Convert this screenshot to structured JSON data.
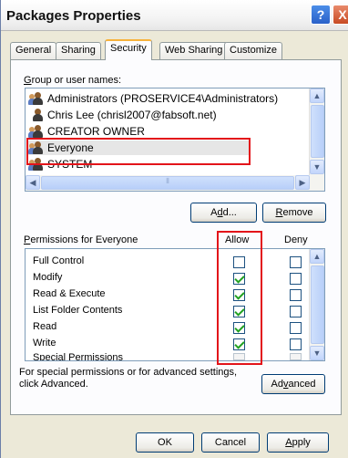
{
  "window": {
    "title": "Packages Properties",
    "help_glyph": "?",
    "close_glyph": "X"
  },
  "tabs": [
    {
      "label": "General",
      "active": false
    },
    {
      "label": "Sharing",
      "active": false
    },
    {
      "label": "Security",
      "active": true
    },
    {
      "label": "Web Sharing",
      "active": false
    },
    {
      "label": "Customize",
      "active": false
    }
  ],
  "security": {
    "group_label_pre": "G",
    "group_label_rest": "roup or user names:",
    "users": [
      {
        "name": "Administrators (PROSERVICE4\\Administrators)",
        "icon": "group-icon"
      },
      {
        "name": "Chris Lee (chrisl2007@fabsoft.net)",
        "icon": "user-icon"
      },
      {
        "name": "CREATOR OWNER",
        "icon": "group-icon"
      },
      {
        "name": "Everyone",
        "icon": "group-icon",
        "selected": true
      },
      {
        "name": "SYSTEM",
        "icon": "group-icon"
      }
    ],
    "add_label_pre": "A",
    "add_label_u": "d",
    "add_label_post": "d...",
    "remove_label_pre": "",
    "remove_label_u": "R",
    "remove_label_post": "emove",
    "permissions_label_u": "P",
    "permissions_label_rest": "ermissions for Everyone",
    "allow_header": "Allow",
    "deny_header": "Deny",
    "permissions": [
      {
        "name": "Full Control",
        "allow": false,
        "deny": false
      },
      {
        "name": "Modify",
        "allow": true,
        "deny": false
      },
      {
        "name": "Read & Execute",
        "allow": true,
        "deny": false
      },
      {
        "name": "List Folder Contents",
        "allow": true,
        "deny": false
      },
      {
        "name": "Read",
        "allow": true,
        "deny": false
      },
      {
        "name": "Write",
        "allow": true,
        "deny": false
      },
      {
        "name": "Special Permissions",
        "allow": false,
        "deny": false
      }
    ],
    "note": "For special permissions or for advanced settings, click Advanced.",
    "advanced_pre": "Ad",
    "advanced_u": "v",
    "advanced_post": "anced"
  },
  "footer": {
    "ok": "OK",
    "cancel": "Cancel",
    "apply_u": "A",
    "apply_rest": "pply"
  },
  "colors": {
    "highlight_box": "#e3141a",
    "check": "#21a121"
  }
}
